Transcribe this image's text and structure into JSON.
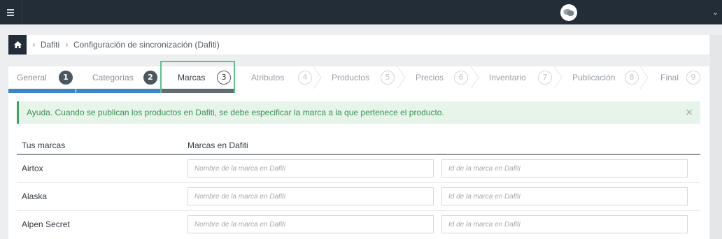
{
  "topbar": {
    "menu_icon": "hamburger-icon",
    "avatar_icon": "chat-bubbles-icon",
    "dropdown_icon": "chevron-down-icon"
  },
  "breadcrumb": {
    "home_icon": "home-icon",
    "items": [
      "Dafiti",
      "Configuración de sincronización (Dafiti)"
    ]
  },
  "stepper": {
    "steps": [
      {
        "label": "General",
        "number": "1",
        "state": "done"
      },
      {
        "label": "Categorías",
        "number": "2",
        "state": "done"
      },
      {
        "label": "Marcas",
        "number": "3",
        "state": "active"
      },
      {
        "label": "Atributos",
        "number": "4",
        "state": "todo"
      },
      {
        "label": "Productos",
        "number": "5",
        "state": "todo"
      },
      {
        "label": "Precios",
        "number": "6",
        "state": "todo"
      },
      {
        "label": "Inventario",
        "number": "7",
        "state": "todo"
      },
      {
        "label": "Publicación",
        "number": "8",
        "state": "todo"
      },
      {
        "label": "Final",
        "number": "9",
        "state": "todo"
      }
    ]
  },
  "help": {
    "text": "Ayuda. Cuando se publican los productos en Dafiti, se debe especificar la marca a la que pertenece el producto.",
    "close": "×"
  },
  "table": {
    "headers": [
      "Tus marcas",
      "Marcas en Dafiti"
    ],
    "name_placeholder": "Nombre de la marca en Dafiti",
    "id_placeholder": "Id de la marca en Dafiti",
    "rows": [
      {
        "brand": "Airtox",
        "name": "",
        "id": ""
      },
      {
        "brand": "Alaska",
        "name": "",
        "id": ""
      },
      {
        "brand": "Alpen Secret",
        "name": "",
        "id": ""
      }
    ]
  },
  "colors": {
    "topbar": "#222d38",
    "accent_blue": "#3d86c6",
    "help_green": "#3fa460",
    "highlight_green": "#5cc48a"
  }
}
